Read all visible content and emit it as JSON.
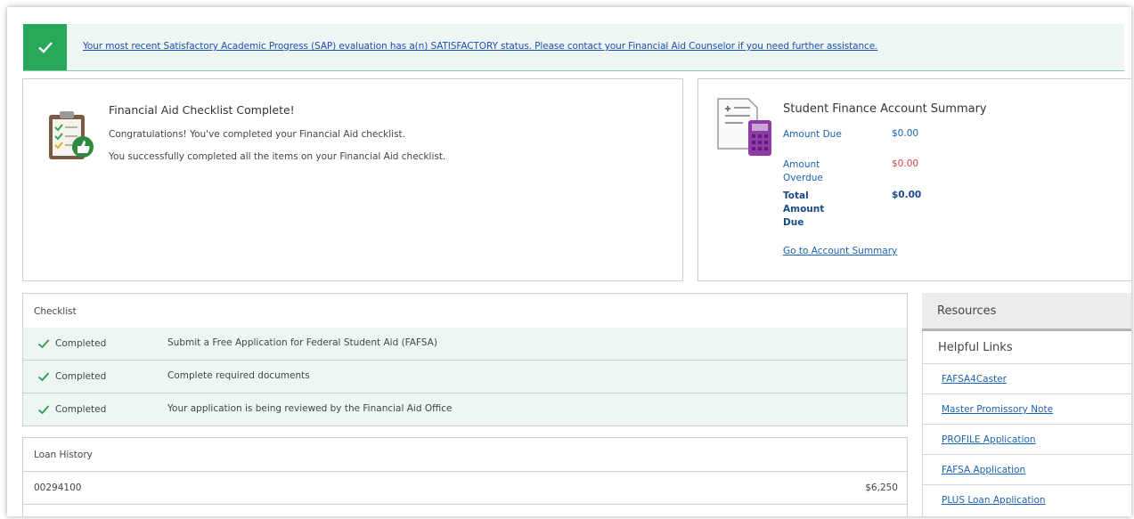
{
  "alert": {
    "message": "Your most recent Satisfactory Academic Progress (SAP) evaluation has a(n) SATISFACTORY status. Please contact your Financial Aid Counselor if you need further assistance.",
    "accent": "#27a85a"
  },
  "financial_aid": {
    "title": "Financial Aid Checklist Complete!",
    "line1": "Congratulations! You've completed your Financial Aid checklist.",
    "line2": "You successfully completed all the items on your Financial Aid checklist.",
    "icon": "clipboard-thumbs-up-icon"
  },
  "finance_summary": {
    "title": "Student Finance Account Summary",
    "icon": "invoice-calculator-icon",
    "amount_due_label": "Amount Due",
    "amount_due_value": "$0.00",
    "amount_overdue_label": "Amount Overdue",
    "amount_overdue_value": "$0.00",
    "total_label": "Total Amount Due",
    "total_value": "$0.00",
    "link": "Go to Account Summary",
    "overdue_color": "#d64545"
  },
  "checklist": {
    "header": "Checklist",
    "items": [
      {
        "status": "Completed",
        "text": "Submit a Free Application for Federal Student Aid (FAFSA)"
      },
      {
        "status": "Completed",
        "text": "Complete required documents"
      },
      {
        "status": "Completed",
        "text": "Your application is being reviewed by the Financial Aid Office"
      }
    ]
  },
  "loan_history": {
    "header": "Loan History",
    "rows": [
      {
        "id": "00294100",
        "amount": "$6,250"
      }
    ]
  },
  "resources": {
    "header": "Resources",
    "helpful_links_header": "Helpful Links",
    "links": [
      "FAFSA4Caster",
      "Master Promissory Note",
      "PROFILE Application",
      "FAFSA Application",
      "PLUS Loan Application"
    ]
  }
}
